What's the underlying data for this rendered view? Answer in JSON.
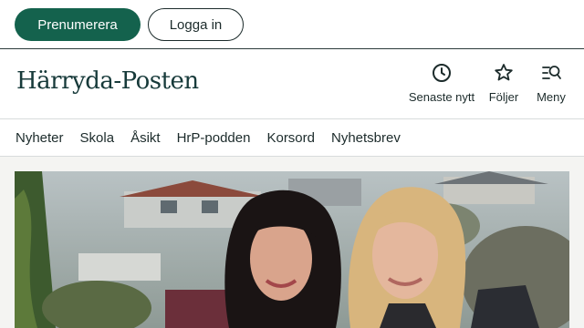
{
  "topbar": {
    "subscribe_label": "Prenumerera",
    "login_label": "Logga in"
  },
  "masthead": {
    "logo_text": "Härryda-Posten",
    "actions": [
      {
        "label": "Senaste nytt",
        "icon": "clock-icon"
      },
      {
        "label": "Följer",
        "icon": "star-icon"
      },
      {
        "label": "Meny",
        "icon": "menu-search-icon"
      }
    ]
  },
  "nav": {
    "items": [
      "Nyheter",
      "Skola",
      "Åsikt",
      "HrP-podden",
      "Korsord",
      "Nyhetsbrev"
    ]
  },
  "hero": {
    "image": "photo-two-women-outdoors"
  },
  "colors": {
    "brand_green": "#14624d",
    "text": "#1c2b2b",
    "divider": "#d8dcdc"
  }
}
